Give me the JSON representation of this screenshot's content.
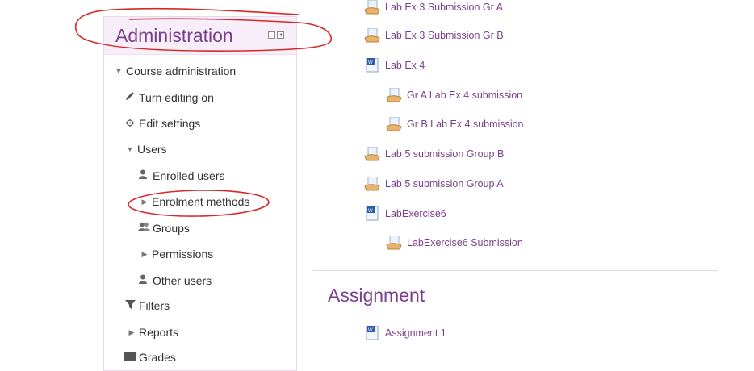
{
  "admin": {
    "title": "Administration",
    "tree": [
      {
        "label": "Course administration",
        "icon": "caret-down-icon"
      },
      {
        "label": "Turn editing on",
        "icon": "pencil-icon"
      },
      {
        "label": "Edit settings",
        "icon": "gear-icon"
      },
      {
        "label": "Users",
        "icon": "caret-down-icon"
      },
      {
        "label": "Enrolled users",
        "icon": "user-icon"
      },
      {
        "label": "Enrolment methods",
        "icon": "caret-right-icon"
      },
      {
        "label": "Groups",
        "icon": "users-icon"
      },
      {
        "label": "Permissions",
        "icon": "caret-right-icon"
      },
      {
        "label": "Other users",
        "icon": "user-icon"
      },
      {
        "label": "Filters",
        "icon": "filter-icon"
      },
      {
        "label": "Reports",
        "icon": "caret-right-icon"
      },
      {
        "label": "Grades",
        "icon": "grades-icon"
      }
    ]
  },
  "activities": [
    {
      "label": "Lab Ex 3 Submission Gr A",
      "icon": "assignment-icon"
    },
    {
      "label": "Lab Ex 3 Submission Gr B",
      "icon": "assignment-icon"
    },
    {
      "label": "Lab Ex 4",
      "icon": "word-doc-icon"
    },
    {
      "label": "Gr A Lab Ex 4 submission",
      "icon": "assignment-icon"
    },
    {
      "label": "Gr B Lab Ex 4 submission",
      "icon": "assignment-icon"
    },
    {
      "label": "Lab 5 submission Group B",
      "icon": "assignment-icon"
    },
    {
      "label": "Lab 5 submission Group A",
      "icon": "assignment-icon"
    },
    {
      "label": "LabExercise6",
      "icon": "word-doc-icon"
    },
    {
      "label": "LabExercise6 Submission",
      "icon": "assignment-icon"
    }
  ],
  "section": {
    "title": "Assignment",
    "items": [
      {
        "label": "Assignment 1",
        "icon": "word-doc-icon"
      }
    ]
  },
  "colors": {
    "accent": "#7a3f8c",
    "annotation": "#d42a2a"
  }
}
